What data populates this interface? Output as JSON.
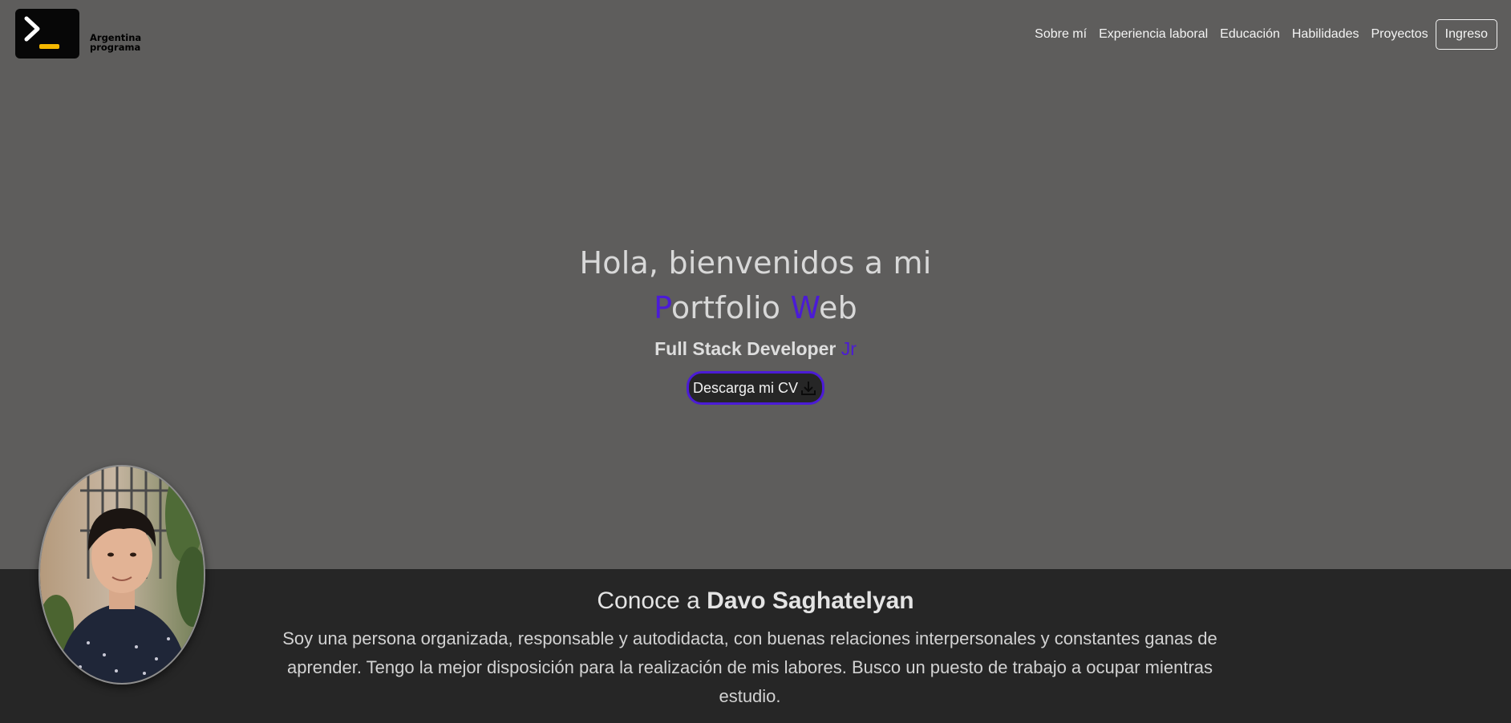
{
  "brand": {
    "line1": "Argentina",
    "line2": "programa",
    "icon": "terminal-prompt-icon",
    "accent_color": "#f5b800"
  },
  "nav": {
    "items": [
      "Sobre mí",
      "Experiencia laboral",
      "Educación",
      "Habilidades",
      "Proyectos"
    ],
    "login_label": "Ingreso"
  },
  "hero": {
    "line1": "Hola, bienvenidos a mi",
    "line2": {
      "p": "P",
      "ortfolio": "ortfolio ",
      "w": "W",
      "eb": "eb"
    },
    "subtitle": "Full Stack Developer ",
    "subtitle_accent": "Jr",
    "cv_button": "Descarga mi CV",
    "accent_color": "#4b1bd6"
  },
  "about": {
    "title_prefix": "Conoce a ",
    "name": "Davo Saghatelyan",
    "description": "Soy una persona organizada, responsable y autodidacta, con buenas relaciones interpersonales y constantes ganas de aprender. Tengo la mejor disposición para la realización de mis labores. Busco un puesto de trabajo a ocupar mientras estudio."
  }
}
